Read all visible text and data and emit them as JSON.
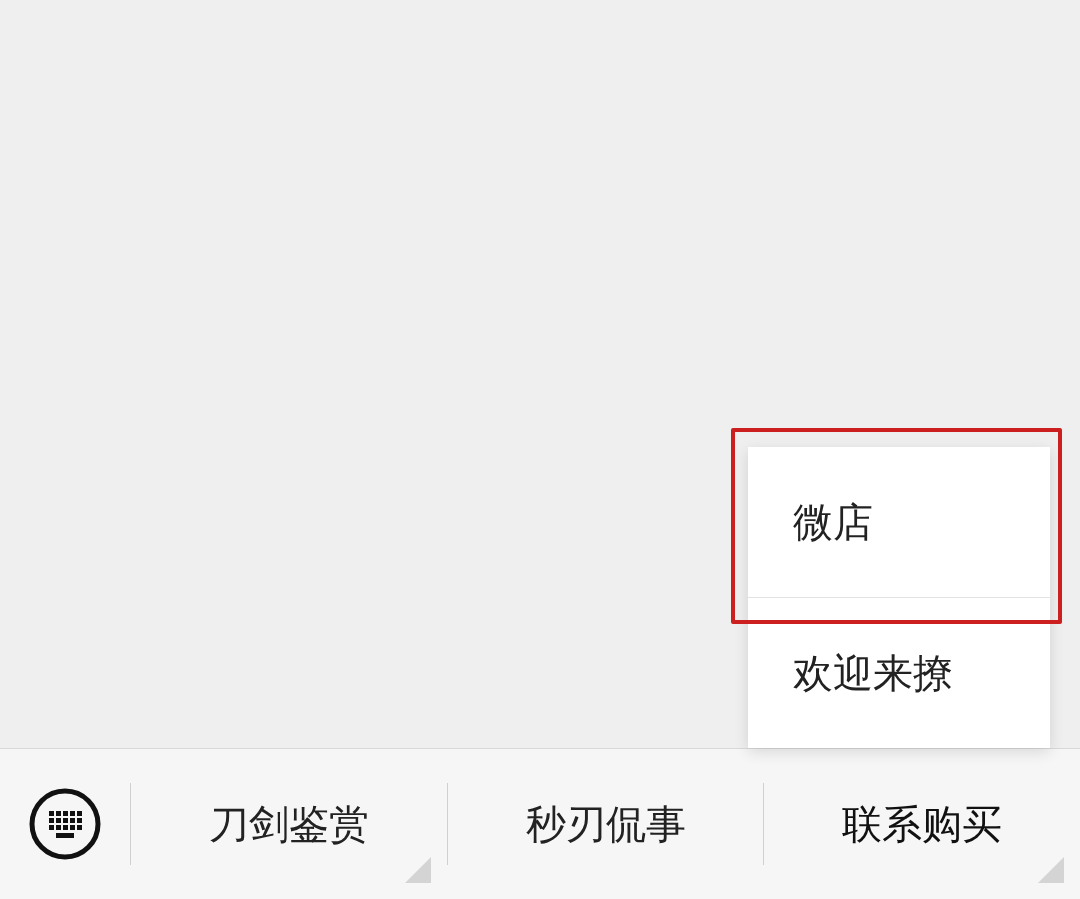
{
  "menu_bar": {
    "items": [
      {
        "label": "刀剑鉴赏",
        "has_submenu": true,
        "expanded": false
      },
      {
        "label": "秒刃侃事",
        "has_submenu": false,
        "expanded": false
      },
      {
        "label": "联系购买",
        "has_submenu": true,
        "expanded": true,
        "submenu": [
          {
            "label": "微店",
            "highlighted": true
          },
          {
            "label": "欢迎来撩",
            "highlighted": false
          }
        ]
      }
    ]
  }
}
